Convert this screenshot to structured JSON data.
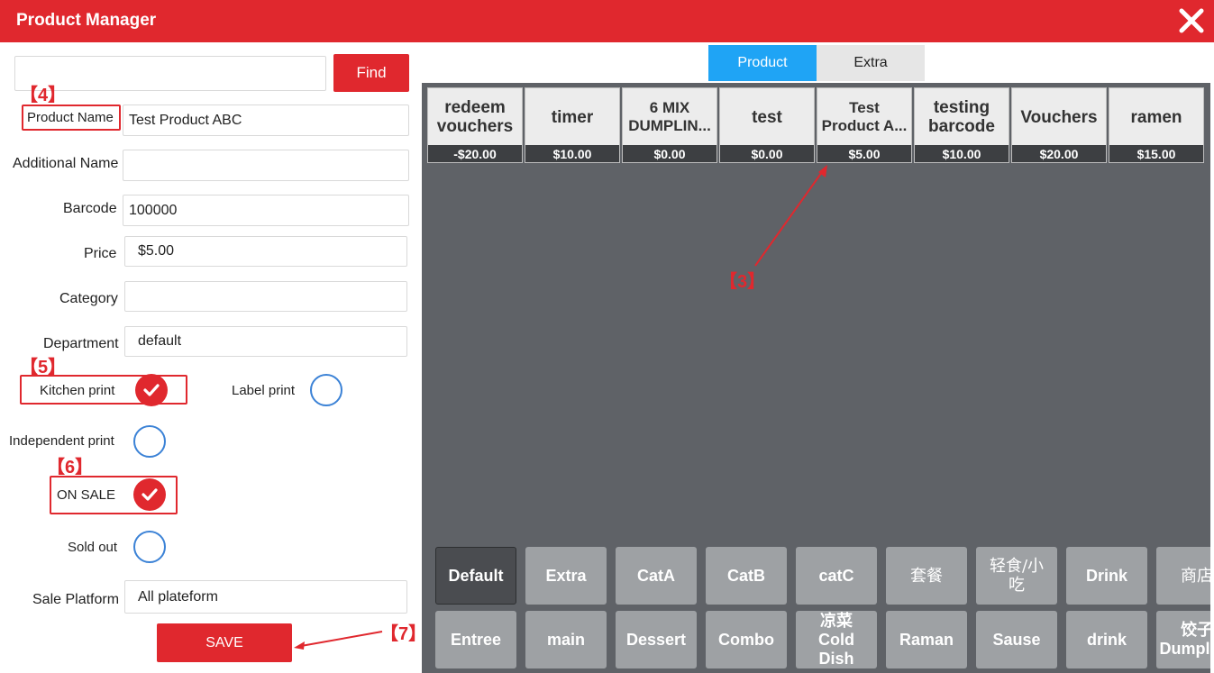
{
  "header": {
    "title": "Product Manager"
  },
  "search": {
    "value": "",
    "find_label": "Find"
  },
  "form": {
    "product_name_label": "Product Name",
    "product_name_value": "Test Product ABC",
    "additional_name_label": "Additional Name",
    "additional_name_value": "",
    "barcode_label": "Barcode",
    "barcode_value": "100000",
    "price_label": "Price",
    "price_value": "$5.00",
    "category_label": "Category",
    "category_value": "",
    "department_label": "Department",
    "department_value": "default",
    "kitchen_print_label": "Kitchen print",
    "label_print_label": "Label print",
    "independent_print_label": "Independent print",
    "on_sale_label": "ON SALE",
    "sold_out_label": "Sold out",
    "sale_platform_label": "Sale Platform",
    "sale_platform_value": "All plateform",
    "save_label": "SAVE"
  },
  "annotations": {
    "a3": "【3】",
    "a4": "【4】",
    "a5": "【5】",
    "a6": "【6】",
    "a7": "【7】"
  },
  "tabs": [
    {
      "label": "Product",
      "active": true
    },
    {
      "label": "Extra",
      "active": false
    }
  ],
  "products": [
    {
      "name": "redeem vouchers",
      "price": "-$20.00"
    },
    {
      "name": "timer",
      "price": "$10.00"
    },
    {
      "name": "6 MIX DUMPLIN...",
      "price": "$0.00"
    },
    {
      "name": "test",
      "price": "$0.00"
    },
    {
      "name": "Test Product A...",
      "price": "$5.00"
    },
    {
      "name": "testing barcode",
      "price": "$10.00"
    },
    {
      "name": "Vouchers",
      "price": "$20.00"
    },
    {
      "name": "ramen",
      "price": "$15.00"
    }
  ],
  "categories_row1": [
    "Default",
    "Extra",
    "CatA",
    "CatB",
    "catC",
    "套餐",
    "轻食/小吃",
    "Drink",
    "商店"
  ],
  "categories_row2": [
    "Entree",
    "main",
    "Dessert",
    "Combo",
    "凉菜 Cold Dish",
    "Raman",
    "Sause",
    "drink",
    "饺子 Dumpling"
  ],
  "colors": {
    "accent": "#e0282e",
    "tab_active": "#1fa4f5",
    "panel": "#5f6267"
  }
}
